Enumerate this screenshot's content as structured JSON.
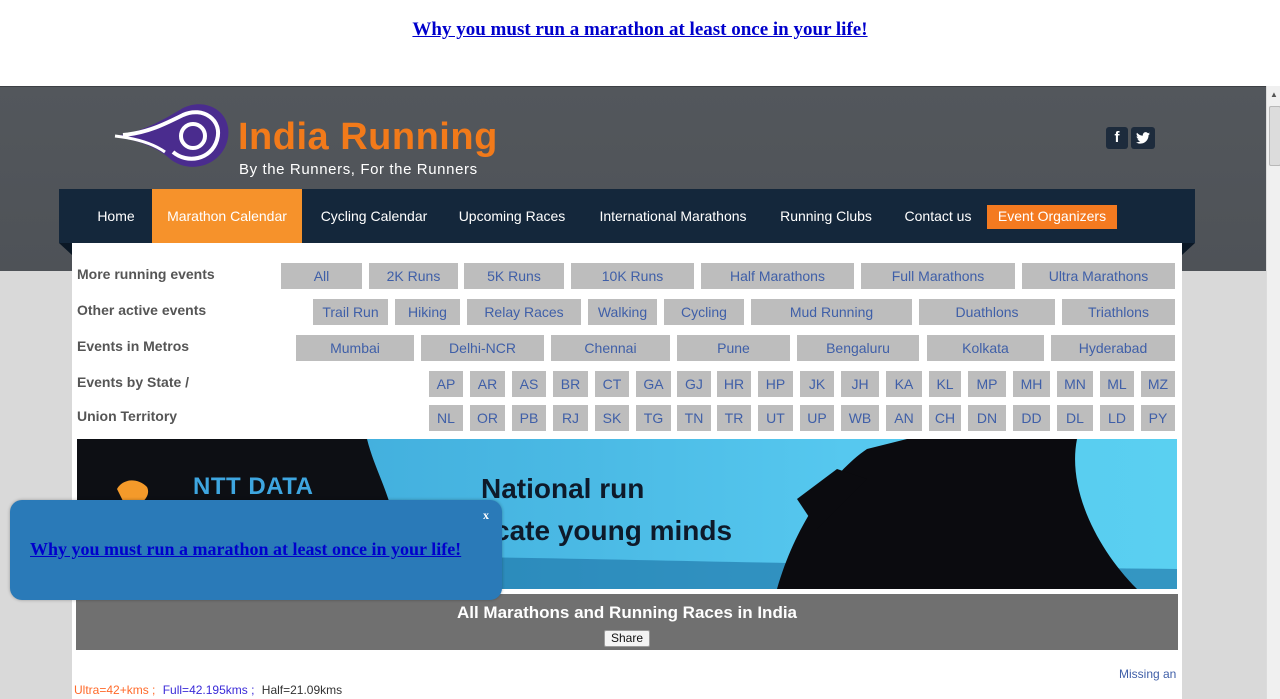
{
  "top_link": "Why you must run a marathon at least once in your life!",
  "logo": {
    "title": "India Running",
    "tagline": "By the Runners, For the Runners"
  },
  "social": {
    "facebook_glyph": "f",
    "twitter_glyph": "t"
  },
  "nav": [
    {
      "label": "Home"
    },
    {
      "label": "Marathon Calendar"
    },
    {
      "label": "Cycling Calendar"
    },
    {
      "label": "Upcoming Races"
    },
    {
      "label": "International Marathons"
    },
    {
      "label": "Running Clubs"
    },
    {
      "label": "Contact us"
    },
    {
      "label": "Event Organizers"
    }
  ],
  "rows": {
    "more_label": "More running events",
    "more": [
      "All",
      "2K Runs",
      "5K Runs",
      "10K Runs",
      "Half Marathons",
      "Full Marathons",
      "Ultra Marathons"
    ],
    "other_label": "Other active events",
    "other": [
      "Trail Run",
      "Hiking",
      "Relay Races",
      "Walking",
      "Cycling",
      "Mud Running",
      "Duathlons",
      "Triathlons"
    ],
    "metros_label": "Events in Metros",
    "metros": [
      "Mumbai",
      "Delhi-NCR",
      "Chennai",
      "Pune",
      "Bengaluru",
      "Kolkata",
      "Hyderabad"
    ],
    "state_label_1": "Events by State /",
    "state_label_2": "Union Territory",
    "states_1": [
      "AP",
      "AR",
      "AS",
      "BR",
      "CT",
      "GA",
      "GJ",
      "HR",
      "HP",
      "JK",
      "JH",
      "KA",
      "KL",
      "MP",
      "MH",
      "MN",
      "ML",
      "MZ"
    ],
    "states_2": [
      "NL",
      "OR",
      "PB",
      "RJ",
      "SK",
      "TG",
      "TN",
      "TR",
      "UT",
      "UP",
      "WB",
      "AN",
      "CH",
      "DN",
      "DD",
      "DL",
      "LD",
      "PY"
    ]
  },
  "banner": {
    "brand": "NTT DATA",
    "line1": "National run",
    "line2": "cate young minds"
  },
  "panel": {
    "title": "All Marathons and Running Races in India",
    "share": "Share"
  },
  "missing": "Missing an",
  "legend": {
    "ultra": "Ultra=42+kms ;",
    "full": "Full=42.195kms ;",
    "half": "Half=21.09kms",
    "ultra_color": "#ff6a2a",
    "full_color": "#3a2ad8",
    "half_color": "#333333"
  },
  "popup": {
    "close": "x",
    "link": "Why you must run a marathon at least once in your life!"
  },
  "colors": {
    "nav_bg": "#14273b",
    "nav_active": "#f6922b",
    "accent_orange": "#f47a20",
    "button_bg": "#bdbdbd",
    "button_text": "#3f5fa8"
  }
}
